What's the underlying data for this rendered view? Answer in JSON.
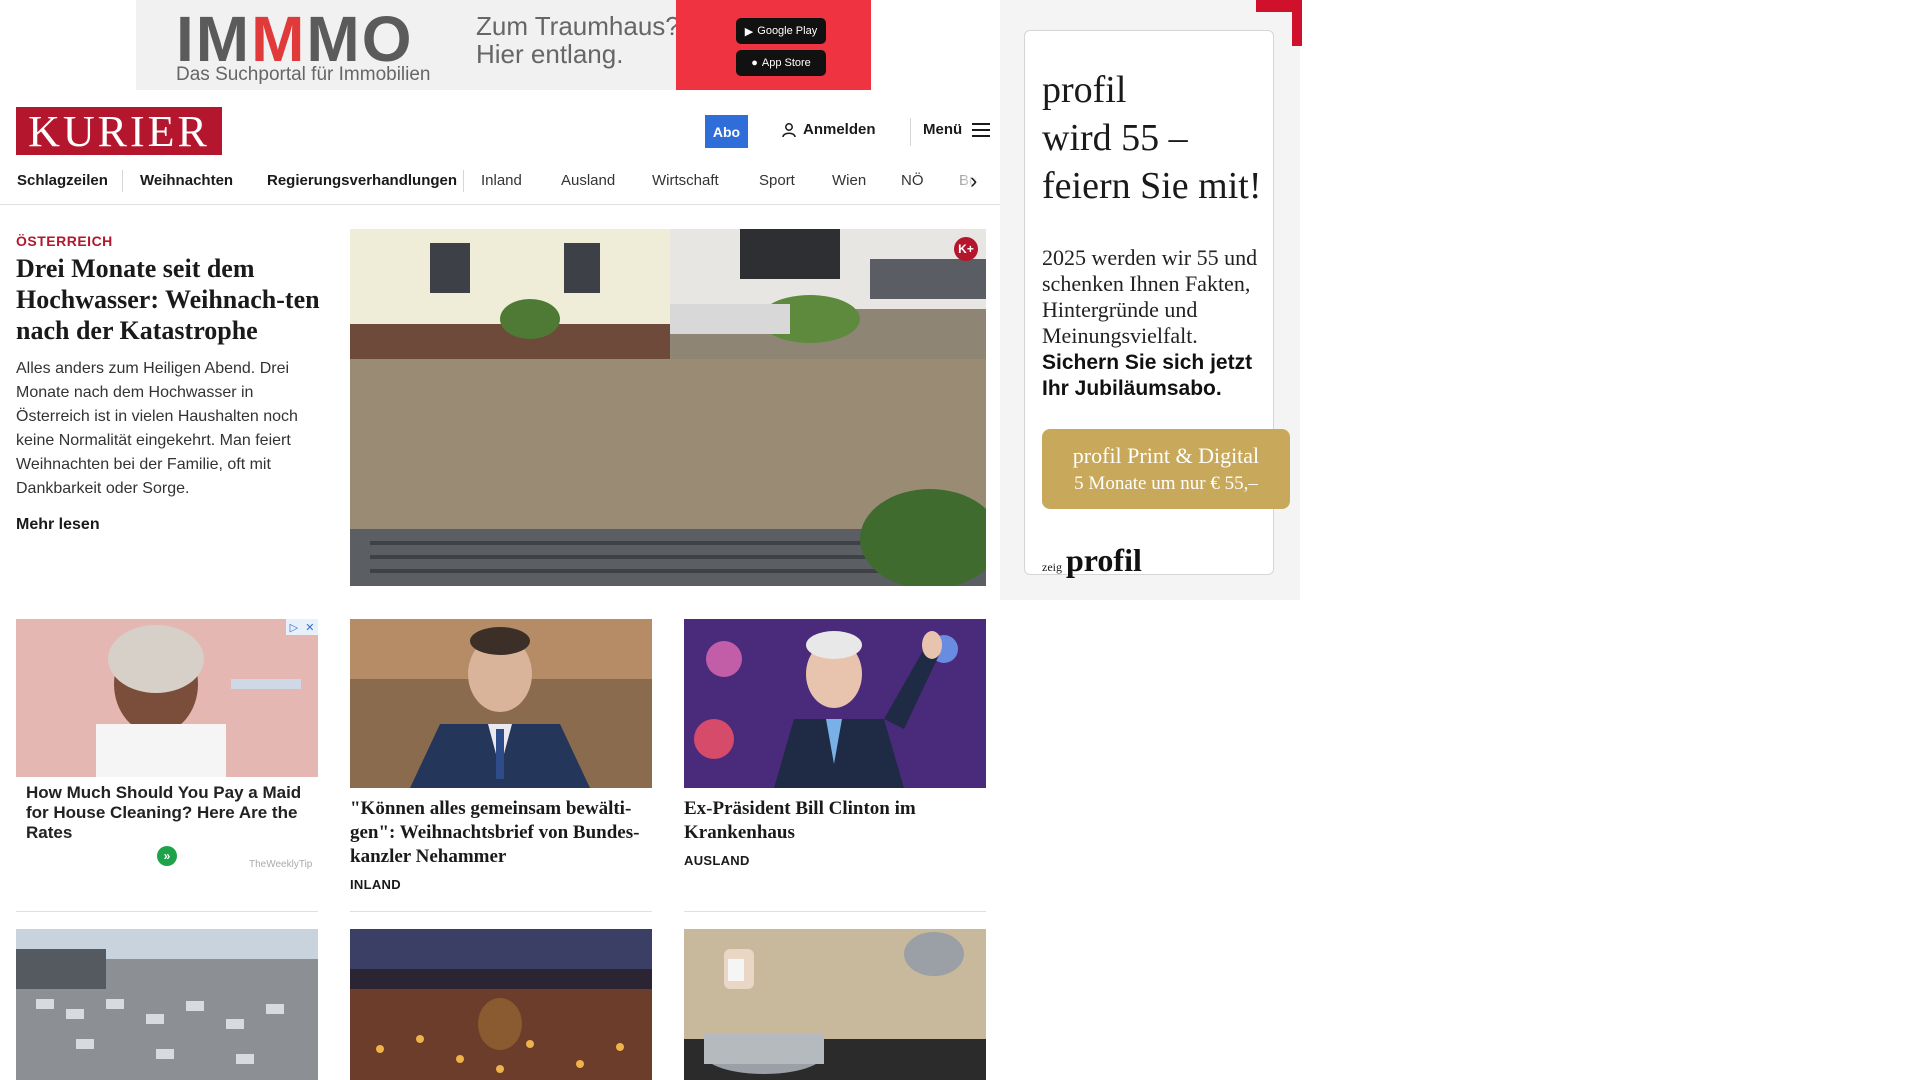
{
  "banner": {
    "logo_pre": "IM",
    "logo_mid": "M",
    "logo_post": "MO",
    "tagline": "Das Suchportal für Immobilien",
    "claim_line1": "Zum Traumhaus?",
    "claim_line2": "Hier entlang.",
    "google_play": "Google Play",
    "app_store": "App Store",
    "accent_color": "#ef3340"
  },
  "header": {
    "logo": "KURIER",
    "abo": "Abo",
    "login": "Anmelden",
    "menu": "Menü",
    "brand_color": "#b3162d"
  },
  "nav": {
    "items": [
      "Schlagzeilen",
      "Weihnachten",
      "Regierungsverhandlungen",
      "Inland",
      "Ausland",
      "Wirtschaft",
      "Sport",
      "Wien",
      "NÖ",
      "Bu"
    ]
  },
  "lead": {
    "kicker": "ÖSTERREICH",
    "title": "Drei Monate seit dem Hochwasser: Weihnach-ten nach der Katastrophe",
    "teaser": "Alles anders zum Heiligen Abend. Drei Monate nach dem Hochwasser in Österreich ist in vielen Haushalten noch keine Normalität eingekehrt. Man feiert Weihnachten bei der Familie, oft mit Dankbarkeit oder Sorge.",
    "more": "Mehr lesen",
    "badge": "K+"
  },
  "ad_card": {
    "title": "How Much Should You Pay a Maid for House Cleaning? Here Are the Rates",
    "source": "TheWeeklyTip",
    "go": "»"
  },
  "cards": [
    {
      "title": "\"Können alles gemeinsam bewälti-gen\": Weihnachtsbrief von Bundes-kanzler Nehammer",
      "category": "INLAND"
    },
    {
      "title": "Ex-Präsident Bill Clinton im Krankenhaus",
      "category": "AUSLAND"
    }
  ],
  "side_ad": {
    "headline_1": "profil",
    "headline_2": "wird 55 –",
    "headline_3": "feiern Sie mit!",
    "body": "2025 werden wir 55 und schenken Ihnen Fakten, Hintergründe und Meinungsvielfalt.",
    "bold": "Sichern Sie sich jetzt Ihr Jubiläumsabo.",
    "cta_1": "profil Print & Digital",
    "cta_2": "5 Monate um nur € 55,–",
    "foot_pre": "zeig",
    "foot_brand": "profil",
    "cta_color": "#c8a85a"
  }
}
